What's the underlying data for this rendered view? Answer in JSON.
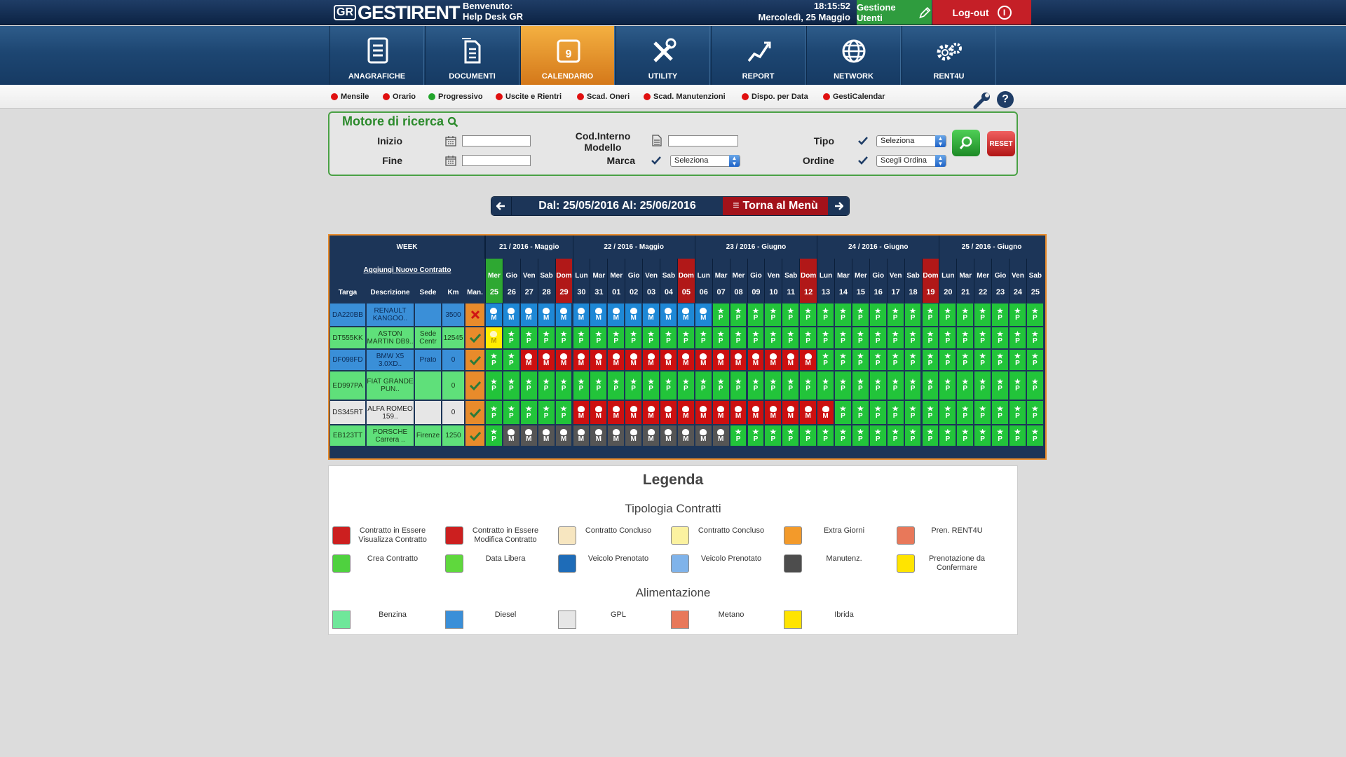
{
  "header": {
    "logo_gr": "GR",
    "logo_text": "GESTIRENT",
    "welcome_line1": "Benvenuto:",
    "welcome_line2": "Help Desk GR",
    "time": "18:15:52",
    "date": "Mercoledì, 25 Maggio",
    "gestione_label": "Gestione Utenti",
    "logout_label": "Log-out"
  },
  "nav": [
    {
      "label": "ANAGRAFICHE",
      "icon": "address-card-icon"
    },
    {
      "label": "DOCUMENTI",
      "icon": "documents-icon"
    },
    {
      "label": "CALENDARIO",
      "icon": "calendar-icon",
      "active": true
    },
    {
      "label": "UTILITY",
      "icon": "tools-icon"
    },
    {
      "label": "REPORT",
      "icon": "chart-report-icon"
    },
    {
      "label": "NETWORK",
      "icon": "globe-icon"
    },
    {
      "label": "RENT4U",
      "icon": "gears-icon"
    }
  ],
  "subnav": [
    {
      "label": "Mensile",
      "color": "#e01010"
    },
    {
      "label": "Orario",
      "color": "#e01010"
    },
    {
      "label": "Progressivo",
      "color": "#22a52c"
    },
    {
      "label": "Uscite e Rientri",
      "color": "#e01010"
    },
    {
      "label": "Scad. Oneri",
      "color": "#e01010"
    },
    {
      "label": "Scad. Manutenzioni",
      "color": "#e01010"
    },
    {
      "label": "Dispo. per Data",
      "color": "#e01010"
    },
    {
      "label": "GestiCalendar",
      "color": "#e01010"
    }
  ],
  "search": {
    "title": "Motore di ricerca",
    "inizio": "Inizio",
    "fine": "Fine",
    "cod_interno_1": "Cod.Interno",
    "cod_interno_2": "Modello",
    "marca": "Marca",
    "marca_value": "Seleziona",
    "tipo": "Tipo",
    "tipo_value": "Seleziona",
    "ordine": "Ordine",
    "ordine_value": "Scegli Ordina",
    "reset": "RESET"
  },
  "datenav": {
    "range": "Dal: 25/05/2016 Al: 25/06/2016",
    "menu": "Torna al Menù"
  },
  "calendar": {
    "week_label": "WEEK",
    "add_contract": "Aggiungi Nuovo Contratto",
    "columns": [
      "Targa",
      "Descrizione",
      "Sede",
      "Km",
      "Man."
    ],
    "weeks": [
      "21 / 2016 - Maggio",
      "22 / 2016 - Maggio",
      "23 / 2016 - Giugno",
      "24 / 2016 - Giugno",
      "25 / 2016 - Giugno"
    ],
    "week_spans": [
      5,
      7,
      7,
      7,
      6
    ],
    "days": [
      {
        "w": "Mer",
        "d": "25"
      },
      {
        "w": "Gio",
        "d": "26"
      },
      {
        "w": "Ven",
        "d": "27"
      },
      {
        "w": "Sab",
        "d": "28"
      },
      {
        "w": "Dom",
        "d": "29"
      },
      {
        "w": "Lun",
        "d": "30"
      },
      {
        "w": "Mar",
        "d": "31"
      },
      {
        "w": "Mer",
        "d": "01"
      },
      {
        "w": "Gio",
        "d": "02"
      },
      {
        "w": "Ven",
        "d": "03"
      },
      {
        "w": "Sab",
        "d": "04"
      },
      {
        "w": "Dom",
        "d": "05"
      },
      {
        "w": "Lun",
        "d": "06"
      },
      {
        "w": "Mar",
        "d": "07"
      },
      {
        "w": "Mer",
        "d": "08"
      },
      {
        "w": "Gio",
        "d": "09"
      },
      {
        "w": "Ven",
        "d": "10"
      },
      {
        "w": "Sab",
        "d": "11"
      },
      {
        "w": "Dom",
        "d": "12"
      },
      {
        "w": "Lun",
        "d": "13"
      },
      {
        "w": "Mar",
        "d": "14"
      },
      {
        "w": "Mer",
        "d": "15"
      },
      {
        "w": "Gio",
        "d": "16"
      },
      {
        "w": "Ven",
        "d": "17"
      },
      {
        "w": "Sab",
        "d": "18"
      },
      {
        "w": "Dom",
        "d": "19"
      },
      {
        "w": "Lun",
        "d": "20"
      },
      {
        "w": "Mar",
        "d": "21"
      },
      {
        "w": "Mer",
        "d": "22"
      },
      {
        "w": "Gio",
        "d": "23"
      },
      {
        "w": "Ven",
        "d": "24"
      },
      {
        "w": "Sab",
        "d": "25"
      }
    ],
    "status_colors": {
      "B": "#1e88d6",
      "G": "#22c43a",
      "R": "#cc1010",
      "K": "#555555",
      "Y": "#ffee00"
    },
    "status_letters": {
      "B": "M",
      "G": "P",
      "R": "M",
      "K": "M",
      "Y": "M"
    },
    "rows": [
      {
        "targa": "DA220BB",
        "desc": "RENAULT KANGOO..",
        "sede": "",
        "km": "3500",
        "man": "x",
        "fuel": "#3a8fd8",
        "cells": "BBBBBBBBBBBBBGGGGGGGGGGGGGGGGGGG"
      },
      {
        "targa": "DT555KK",
        "desc": "ASTON MARTIN DB9..",
        "sede": "Sede Centr",
        "km": "12545",
        "man": "ok",
        "fuel": "#5fe07a",
        "cells": "YGGGGGGGGGGGGGGGGGGGGGGGGGGGGGGG"
      },
      {
        "targa": "DF098FD",
        "desc": "BMW X5 3.0XD..",
        "sede": "Prato",
        "km": "0",
        "man": "ok",
        "fuel": "#3a8fd8",
        "cells": "GGRRRRRRRRRRRRRRRRRGGGGGGGGGGGGG"
      },
      {
        "targa": "ED997PA",
        "desc": "FIAT GRANDE PUN..",
        "sede": "",
        "km": "0",
        "man": "ok",
        "fuel": "#5fe07a",
        "cells": "GGGGGGGGGGGGGGGGGGGGGGGGGGGGGGGG"
      },
      {
        "targa": "DS345RT",
        "desc": "ALFA ROMEO 159..",
        "sede": "",
        "km": "0",
        "man": "ok",
        "fuel": "#e6e6e6",
        "cells": "GGGGGRRRRRRRRRRRRRRRGGGGGGGGGGGG"
      },
      {
        "targa": "EB123TT",
        "desc": "PORSCHE Carrera ..",
        "sede": "Firenze",
        "km": "1250",
        "man": "ok",
        "fuel": "#5fe07a",
        "cells": "GKKKKKKKKKKKKKGGGGGGGGGGGGGGGGGG"
      }
    ]
  },
  "legend": {
    "title": "Legenda",
    "contracts_title": "Tipologia Contratti",
    "fuel_title": "Alimentazione",
    "contracts": [
      {
        "label": "Contratto in Essere Visualizza Contratto",
        "color": "#cc1f1f"
      },
      {
        "label": "Contratto in Essere Modifica Contratto",
        "color": "#cc1f1f"
      },
      {
        "label": "Contratto Concluso",
        "color": "#f7e6c0"
      },
      {
        "label": "Contratto Concluso",
        "color": "#fbf2a0"
      },
      {
        "label": "Extra Giorni",
        "color": "#f39a2a"
      },
      {
        "label": "Pren. RENT4U",
        "color": "#e8785a"
      },
      {
        "label": "Crea Contratto",
        "color": "#4fd13f"
      },
      {
        "label": "Data Libera",
        "color": "#5fd83d"
      },
      {
        "label": "Veicolo Prenotato",
        "color": "#1e6cb8"
      },
      {
        "label": "Veicolo Prenotato",
        "color": "#7fb3ea"
      },
      {
        "label": "Manutenz.",
        "color": "#4d4d4d"
      },
      {
        "label": "Prenotazione da Confermare",
        "color": "#ffe400"
      }
    ],
    "fuels": [
      {
        "label": "Benzina",
        "color": "#6fe79a"
      },
      {
        "label": "Diesel",
        "color": "#3a8fd8"
      },
      {
        "label": "GPL",
        "color": "#e6e6e6"
      },
      {
        "label": "Metano",
        "color": "#e8785a"
      },
      {
        "label": "Ibrida",
        "color": "#ffe400"
      }
    ]
  }
}
